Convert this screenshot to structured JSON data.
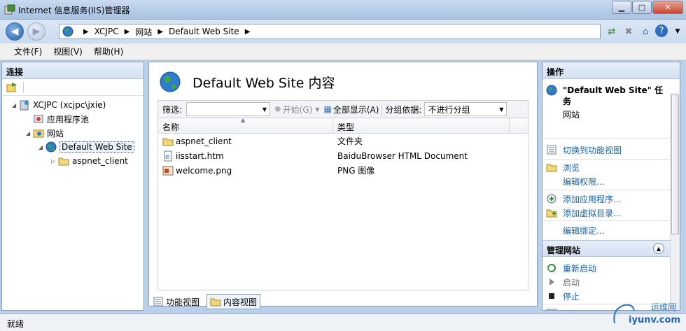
{
  "window": {
    "title": "Internet 信息服务(IIS)管理器"
  },
  "address": {
    "crumbs": [
      "XCJPC",
      "网站",
      "Default Web Site"
    ]
  },
  "menu": [
    "文件(F)",
    "视图(V)",
    "帮助(H)"
  ],
  "connections": {
    "title": "连接",
    "tree": {
      "server": "XCJPC (xcjpc\\jxie)",
      "app_pools": "应用程序池",
      "sites": "网站",
      "site": "Default Web Site",
      "folder": "aspnet_client"
    }
  },
  "content": {
    "heading": "Default Web Site 内容",
    "filter_label": "筛选:",
    "filter_value": "",
    "go_button": "开始(G)",
    "show_all": "全部显示(A)",
    "group_by_label": "分组依据:",
    "group_by_value": "不进行分组",
    "columns": [
      "名称",
      "类型"
    ],
    "rows": [
      {
        "name": "aspnet_client",
        "type": "文件夹",
        "icon": "folder-icon"
      },
      {
        "name": "iisstart.htm",
        "type": "BaiduBrowser HTML Document",
        "icon": "html-file-icon"
      },
      {
        "name": "welcome.png",
        "type": "PNG 图像",
        "icon": "image-file-icon"
      }
    ]
  },
  "view_tabs": [
    "功能视图",
    "内容视图"
  ],
  "actions": {
    "title": "操作",
    "task_title": "\"Default Web Site\" 任务",
    "task_sub": "网站",
    "switch_view": "切换到功能视图",
    "browse": "浏览",
    "edit_perms": "编辑权限...",
    "add_app": "添加应用程序...",
    "add_vdir": "添加虚拟目录...",
    "edit_bindings": "编辑绑定...",
    "manage_site": "管理网站",
    "restart": "重新启动",
    "start": "启动",
    "stop": "停止",
    "browse2": "浏览"
  },
  "status": "就绪",
  "watermark": {
    "line1": "运维网",
    "line2": "iyunv.com"
  }
}
